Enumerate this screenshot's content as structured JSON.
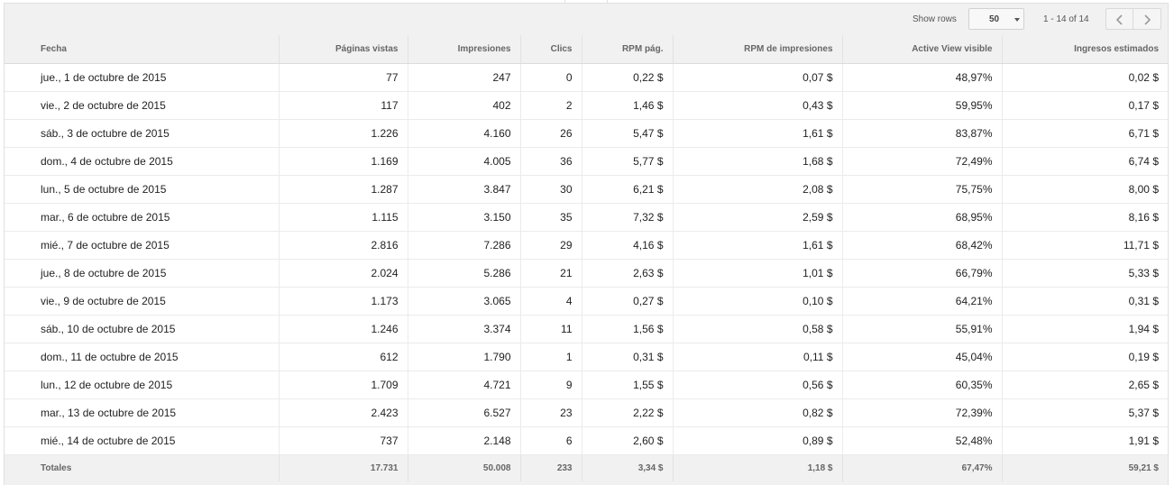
{
  "toolbar": {
    "show_rows_label": "Show rows",
    "rows_per_page": "50",
    "range_text": "1 - 14 of 14",
    "prev_icon": "chevron-left-icon",
    "next_icon": "chevron-right-icon"
  },
  "table": {
    "headers": [
      "Fecha",
      "Páginas vistas",
      "Impresiones",
      "Clics",
      "RPM pág.",
      "RPM de impresiones",
      "Active View visible",
      "Ingresos estimados"
    ],
    "rows": [
      [
        "jue., 1 de octubre de 2015",
        "77",
        "247",
        "0",
        "0,22 $",
        "0,07 $",
        "48,97%",
        "0,02 $"
      ],
      [
        "vie., 2 de octubre de 2015",
        "117",
        "402",
        "2",
        "1,46 $",
        "0,43 $",
        "59,95%",
        "0,17 $"
      ],
      [
        "sáb., 3 de octubre de 2015",
        "1.226",
        "4.160",
        "26",
        "5,47 $",
        "1,61 $",
        "83,87%",
        "6,71 $"
      ],
      [
        "dom., 4 de octubre de 2015",
        "1.169",
        "4.005",
        "36",
        "5,77 $",
        "1,68 $",
        "72,49%",
        "6,74 $"
      ],
      [
        "lun., 5 de octubre de 2015",
        "1.287",
        "3.847",
        "30",
        "6,21 $",
        "2,08 $",
        "75,75%",
        "8,00 $"
      ],
      [
        "mar., 6 de octubre de 2015",
        "1.115",
        "3.150",
        "35",
        "7,32 $",
        "2,59 $",
        "68,95%",
        "8,16 $"
      ],
      [
        "mié., 7 de octubre de 2015",
        "2.816",
        "7.286",
        "29",
        "4,16 $",
        "1,61 $",
        "68,42%",
        "11,71 $"
      ],
      [
        "jue., 8 de octubre de 2015",
        "2.024",
        "5.286",
        "21",
        "2,63 $",
        "1,01 $",
        "66,79%",
        "5,33 $"
      ],
      [
        "vie., 9 de octubre de 2015",
        "1.173",
        "3.065",
        "4",
        "0,27 $",
        "0,10 $",
        "64,21%",
        "0,31 $"
      ],
      [
        "sáb., 10 de octubre de 2015",
        "1.246",
        "3.374",
        "11",
        "1,56 $",
        "0,58 $",
        "55,91%",
        "1,94 $"
      ],
      [
        "dom., 11 de octubre de 2015",
        "612",
        "1.790",
        "1",
        "0,31 $",
        "0,11 $",
        "45,04%",
        "0,19 $"
      ],
      [
        "lun., 12 de octubre de 2015",
        "1.709",
        "4.721",
        "9",
        "1,55 $",
        "0,56 $",
        "60,35%",
        "2,65 $"
      ],
      [
        "mar., 13 de octubre de 2015",
        "2.423",
        "6.527",
        "23",
        "2,22 $",
        "0,82 $",
        "72,39%",
        "5,37 $"
      ],
      [
        "mié., 14 de octubre de 2015",
        "737",
        "2.148",
        "6",
        "2,60 $",
        "0,89 $",
        "52,48%",
        "1,91 $"
      ]
    ],
    "totals": [
      "Totales",
      "17.731",
      "50.008",
      "233",
      "3,34 $",
      "1,18 $",
      "67,47%",
      "59,21 $"
    ]
  }
}
